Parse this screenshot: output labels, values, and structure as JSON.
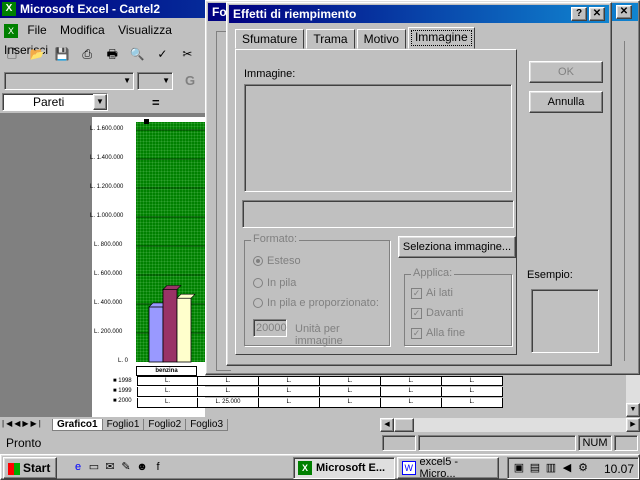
{
  "app_title": "Microsoft Excel - Cartel2",
  "menu": [
    "File",
    "Modifica",
    "Visualizza",
    "Inserisci"
  ],
  "name_box": "Pareti",
  "formula_eq": "=",
  "chart": {
    "y_labels": [
      "L. 1.600.000",
      "L. 1.400.000",
      "L. 1.200.000",
      "L. 1.000.000",
      "L. 800.000",
      "L. 600.000",
      "L. 400.000",
      "L. 200.000",
      "L. 0"
    ],
    "category": "benzina",
    "legend": [
      "1998",
      "1999",
      "2000"
    ],
    "rows": [
      [
        "L.",
        "L.",
        "L.",
        "L.",
        "L.",
        "L."
      ],
      [
        "L.",
        "L.",
        "L.",
        "L.",
        "L.",
        "L."
      ],
      [
        "L.",
        "L. 25.000",
        "L.",
        "L.",
        "L.",
        "L."
      ]
    ]
  },
  "chart_data": {
    "type": "bar",
    "categories": [
      "benzina"
    ],
    "series": [
      {
        "name": "1998",
        "values": [
          380000
        ]
      },
      {
        "name": "1999",
        "values": [
          500000
        ]
      },
      {
        "name": "2000",
        "values": [
          440000
        ]
      }
    ],
    "ylim": [
      0,
      1600000
    ],
    "colors": [
      "#9999ff",
      "#993366",
      "#ffffcc"
    ]
  },
  "sheet_tabs": [
    "Grafico1",
    "Foglio1",
    "Foglio2",
    "Foglio3"
  ],
  "status": {
    "text": "Pronto",
    "num": "NUM"
  },
  "behind_window_fragment": "Fo",
  "dialog": {
    "title": "Effetti di riempimento",
    "tabs": [
      "Sfumature",
      "Trama",
      "Motivo",
      "Immagine"
    ],
    "active_tab": "Immagine",
    "image_label": "Immagine:",
    "format_group": "Formato:",
    "opt_esteso": "Esteso",
    "opt_pila": "In pila",
    "opt_pila_prop": "In pila e proporzionato:",
    "units_value": "20000",
    "units_label": "Unità per immagine",
    "select_button": "Seleziona immagine...",
    "apply_group": "Applica:",
    "chk_lati": "Ai lati",
    "chk_davanti": "Davanti",
    "chk_fine": "Alla fine",
    "ok": "OK",
    "cancel": "Annulla",
    "sample_label": "Esempio:"
  },
  "taskbar": {
    "start": "Start",
    "tasks": [
      "Microsoft E...",
      "excel5 - Micro..."
    ],
    "clock": "10.07"
  }
}
